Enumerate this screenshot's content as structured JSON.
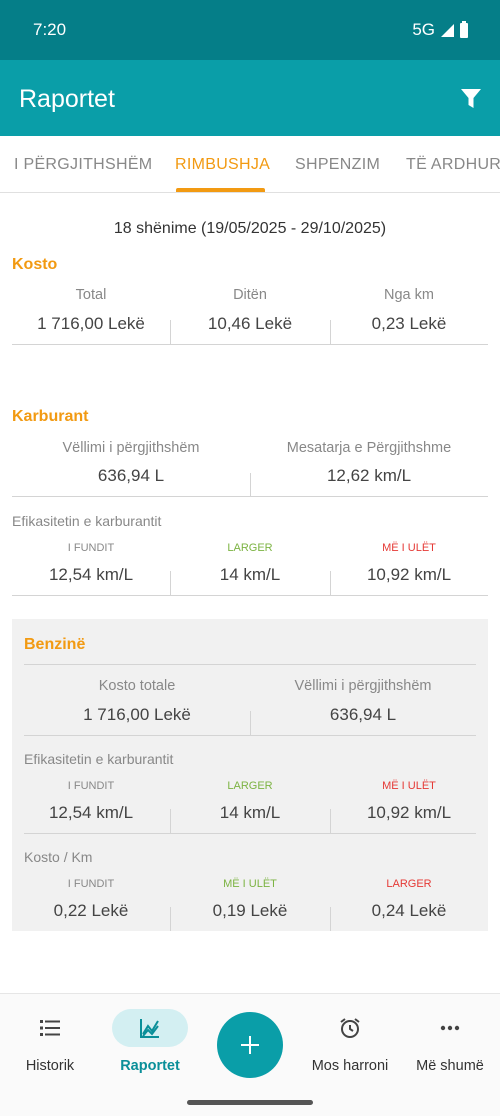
{
  "status_bar": {
    "time": "7:20",
    "network": "5G"
  },
  "app_bar": {
    "title": "Raportet",
    "filter_icon": "filter-icon"
  },
  "tabs": [
    {
      "label": "I PËRGJITHSHËM"
    },
    {
      "label": "RIMBUSHJA"
    },
    {
      "label": "SHPENZIM"
    },
    {
      "label": "TË ARDHURA"
    }
  ],
  "active_tab": "RIMBUSHJA",
  "summary": "18 shënime (19/05/2025 - 29/10/2025)",
  "kosto": {
    "title": "Kosto",
    "cells": [
      {
        "label": "Total",
        "value": "1 716,00 Lekë"
      },
      {
        "label": "Ditën",
        "value": "10,46 Lekë"
      },
      {
        "label": "Nga km",
        "value": "0,23 Lekë"
      }
    ]
  },
  "karburant": {
    "title": "Karburant",
    "cells": [
      {
        "label": "Vëllimi i përgjithshëm",
        "value": "636,94 L"
      },
      {
        "label": "Mesatarja e Përgjithshme",
        "value": "12,62 km/L"
      }
    ],
    "efficiency": {
      "title": "Efikasitetin e karburantit",
      "cells": [
        {
          "label": "I FUNDIT",
          "value": "12,54 km/L"
        },
        {
          "label": "LARGER",
          "value": "14 km/L"
        },
        {
          "label": "MË I ULËT",
          "value": "10,92 km/L"
        }
      ]
    }
  },
  "benzine": {
    "title": "Benzinë",
    "cells": [
      {
        "label": "Kosto totale",
        "value": "1 716,00 Lekë"
      },
      {
        "label": "Vëllimi i përgjithshëm",
        "value": "636,94 L"
      }
    ],
    "efficiency": {
      "title": "Efikasitetin e karburantit",
      "cells": [
        {
          "label": "I FUNDIT",
          "value": "12,54 km/L"
        },
        {
          "label": "LARGER",
          "value": "14 km/L"
        },
        {
          "label": "MË I ULËT",
          "value": "10,92 km/L"
        }
      ]
    },
    "cost_per_km": {
      "title": "Kosto / Km",
      "cells": [
        {
          "label": "I FUNDIT",
          "value": "0,22 Lekë"
        },
        {
          "label": "MË I ULËT",
          "value": "0,19 Lekë"
        },
        {
          "label": "LARGER",
          "value": "0,24 Lekë"
        }
      ]
    }
  },
  "colors": {
    "primary": "#0a9ea8",
    "status_bar": "#057e88",
    "accent": "#f29a12",
    "green": "#7cb342",
    "red": "#e53935"
  },
  "bottom_nav": [
    {
      "label": "Historik",
      "icon": "list-icon"
    },
    {
      "label": "Raportet",
      "icon": "chart-icon"
    },
    {
      "label": "",
      "icon": "plus-icon"
    },
    {
      "label": "Mos harroni",
      "icon": "alarm-icon"
    },
    {
      "label": "Më shumë",
      "icon": "more-dots-icon"
    }
  ]
}
